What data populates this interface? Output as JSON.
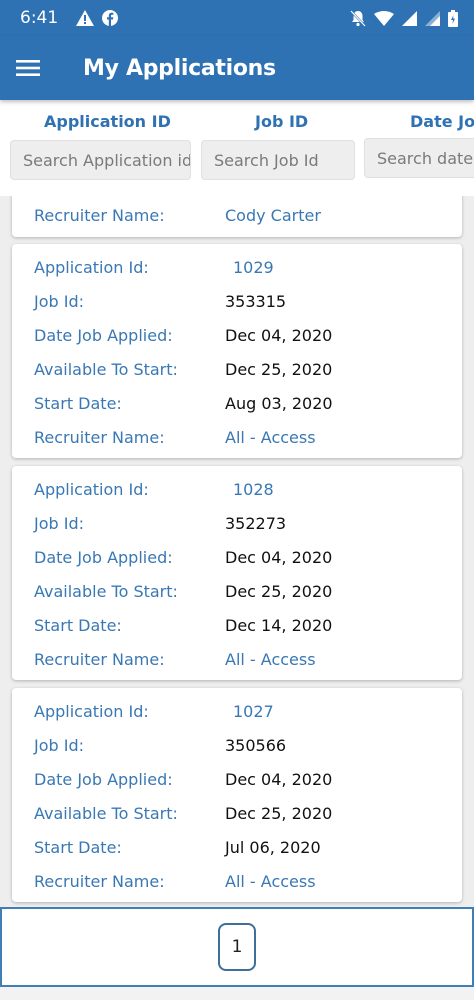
{
  "status_bar": {
    "time": "6:41",
    "left_icons": [
      "warning-icon",
      "facebook-icon"
    ],
    "right_icons": [
      "bell-off-icon",
      "wifi-icon",
      "signal-icon",
      "signal-icon",
      "battery-icon"
    ]
  },
  "app_bar": {
    "title": "My Applications",
    "menu_icon": "hamburger-menu-icon"
  },
  "filters": [
    {
      "label": "Application ID",
      "placeholder": "Search Application id"
    },
    {
      "label": "Job ID",
      "placeholder": "Search Job Id"
    },
    {
      "label": "Date Job",
      "placeholder": "Search date job"
    }
  ],
  "partial_card": {
    "rows": [
      {
        "label": "Recruiter Name:",
        "value": "Cody Carter",
        "link": true
      }
    ]
  },
  "cards": [
    {
      "rows": [
        {
          "label": "Application Id:",
          "value": "1029",
          "link": true
        },
        {
          "label": "Job Id:",
          "value": "353315",
          "link": false
        },
        {
          "label": "Date Job Applied:",
          "value": "Dec 04, 2020",
          "link": false
        },
        {
          "label": "Available To Start:",
          "value": "Dec 25, 2020",
          "link": false
        },
        {
          "label": "Start Date:",
          "value": "Aug 03, 2020",
          "link": false
        },
        {
          "label": "Recruiter Name:",
          "value": "All - Access",
          "link": true
        }
      ]
    },
    {
      "rows": [
        {
          "label": "Application Id:",
          "value": "1028",
          "link": true
        },
        {
          "label": "Job Id:",
          "value": "352273",
          "link": false
        },
        {
          "label": "Date Job Applied:",
          "value": "Dec 04, 2020",
          "link": false
        },
        {
          "label": "Available To Start:",
          "value": "Dec 25, 2020",
          "link": false
        },
        {
          "label": "Start Date:",
          "value": "Dec 14, 2020",
          "link": false
        },
        {
          "label": "Recruiter Name:",
          "value": "All - Access",
          "link": true
        }
      ]
    },
    {
      "rows": [
        {
          "label": "Application Id:",
          "value": "1027",
          "link": true
        },
        {
          "label": "Job Id:",
          "value": "350566",
          "link": false
        },
        {
          "label": "Date Job Applied:",
          "value": "Dec 04, 2020",
          "link": false
        },
        {
          "label": "Available To Start:",
          "value": "Dec 25, 2020",
          "link": false
        },
        {
          "label": "Start Date:",
          "value": "Jul 06, 2020",
          "link": false
        },
        {
          "label": "Recruiter Name:",
          "value": "All - Access",
          "link": true
        }
      ]
    }
  ],
  "pager": {
    "current_page": "1"
  },
  "colors": {
    "primary": "#2f72b4",
    "label": "#3978b4"
  }
}
